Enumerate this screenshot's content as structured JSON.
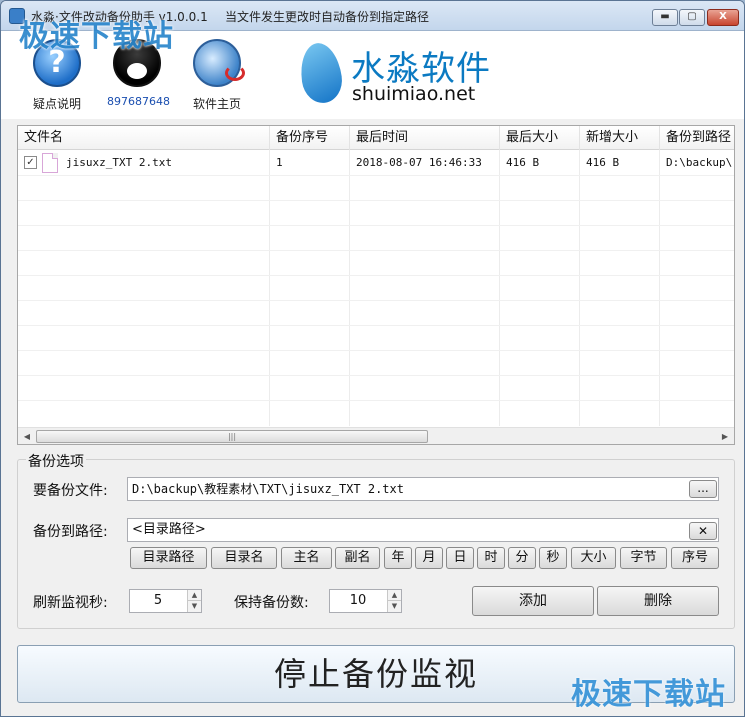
{
  "window": {
    "title": "水淼·文件改动备份助手 v1.0.0.1",
    "subtitle": "当文件发生更改时自动备份到指定路径",
    "minimize_label": "▬",
    "maximize_label": "▢",
    "close_label": "X"
  },
  "watermark": {
    "text": "极速下载站"
  },
  "toolbar": {
    "items": [
      {
        "label": "疑点说明",
        "icon": "help-icon"
      },
      {
        "label": "897687648",
        "icon": "qq-penguin-icon"
      },
      {
        "label": "软件主页",
        "icon": "globe-icon"
      }
    ],
    "help_glyph": "?"
  },
  "logo": {
    "cn": "水淼软件",
    "en": "shuimiao.net"
  },
  "file_list": {
    "columns": [
      "文件名",
      "备份序号",
      "最后时间",
      "最后大小",
      "新增大小",
      "备份到路径"
    ],
    "rows": [
      {
        "checked": true,
        "name": "jisuxz_TXT 2.txt",
        "seq": "1",
        "time": "2018-08-07 16:46:33",
        "last_size": "416 B",
        "new_size": "416 B",
        "path": "D:\\backup\\"
      }
    ],
    "check_mark": "✓",
    "scroll_left": "◀",
    "scroll_right": "▶",
    "scroll_grip": "|||"
  },
  "options": {
    "group_title": "备份选项",
    "source_label": "要备份文件:",
    "source_value": "D:\\backup\\教程素材\\TXT\\jisuxz_TXT 2.txt",
    "browse_label": "...",
    "dest_label": "备份到路径:",
    "dest_value": "<目录路径>",
    "clear_label": "✕",
    "tokens": [
      "目录路径",
      "目录名",
      "主名",
      "副名",
      "年",
      "月",
      "日",
      "时",
      "分",
      "秒",
      "大小",
      "字节",
      "序号"
    ],
    "refresh_label": "刷新监视秒:",
    "refresh_value": "5",
    "keep_label": "保持备份数:",
    "keep_value": "10",
    "spin_up": "▲",
    "spin_down": "▼",
    "add_label": "添加",
    "delete_label": "删除"
  },
  "main_action": {
    "label": "停止备份监视"
  }
}
